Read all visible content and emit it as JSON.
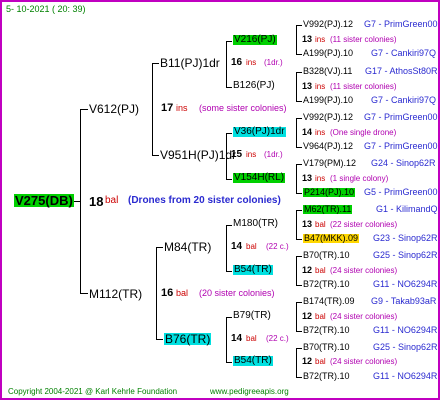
{
  "header": {
    "date": "5- 10-2021 ( 20: 39)"
  },
  "root": {
    "name": "V275(DB)",
    "num": "18",
    "unit": "bal",
    "note": "(Drones from 20 sister colonies)"
  },
  "gen1": [
    {
      "name": "V612(PJ)",
      "num": "17",
      "unit": "ins",
      "note": "(some sister colonies)"
    },
    {
      "name": "M112(TR)",
      "num": "16",
      "unit": "bal",
      "note": "(20 sister colonies)"
    }
  ],
  "gen2": [
    {
      "name": "B11(PJ)1dr",
      "num": "16",
      "unit": "ins",
      "note": "(1dr.)"
    },
    {
      "name": "V951H(PJ)1dr",
      "num": "15",
      "unit": "ins",
      "note": "(1dr.)"
    },
    {
      "name": "M84(TR)",
      "num": "14",
      "unit": "bal",
      "note": "(22 c.)"
    },
    {
      "name": "B76(TR)",
      "num": "14",
      "unit": "bal",
      "note": "(22 c.)"
    }
  ],
  "gen3": [
    {
      "name": "V216(PJ)",
      "num": "13",
      "unit": "ins",
      "note": "(11 sister colonies)"
    },
    {
      "name": "B126(PJ)",
      "num": "13",
      "unit": "ins",
      "note": "(11 sister colonies)"
    },
    {
      "name": "V36(PJ)1dr",
      "num": "14",
      "unit": "ins",
      "note": "(One single drone)"
    },
    {
      "name": "V154H(RL)",
      "num": "13",
      "unit": "ins",
      "note": "(1 single colony)"
    },
    {
      "name": "M180(TR)",
      "num": "13",
      "unit": "bal",
      "note": "(22 sister colonies)"
    },
    {
      "name": "B54(TR)",
      "num": "12",
      "unit": "bal",
      "note": "(24 sister colonies)"
    },
    {
      "name": "B79(TR)",
      "num": "12",
      "unit": "bal",
      "note": "(24 sister colonies)"
    },
    {
      "name": "B54(TR)",
      "num": "12",
      "unit": "bal",
      "note": "(24 sister colonies)"
    }
  ],
  "gen4": [
    {
      "name": "V992(PJ).12",
      "code": "G7 - PrimGreen00"
    },
    {
      "name": "A199(PJ).10",
      "code": "G7 - Cankiri97Q"
    },
    {
      "name": "B328(VJ).11",
      "code": "G17 - AthosSt80R"
    },
    {
      "name": "A199(PJ).10",
      "code": "G7 - Cankiri97Q"
    },
    {
      "name": "V992(PJ).12",
      "code": "G7 - PrimGreen00"
    },
    {
      "name": "V964(PJ).12",
      "code": "G7 - PrimGreen00"
    },
    {
      "name": "V179(PM).12",
      "code": "G24 - Sinop62R"
    },
    {
      "name": "P214(PJ).10",
      "code": "G5 - PrimGreen00"
    },
    {
      "name": "M62(TR).11",
      "code": "G1 - KilimandQ"
    },
    {
      "name": "B47(MKK).09",
      "code": "G23 - Sinop62R"
    },
    {
      "name": "B70(TR).10",
      "code": "G25 - Sinop62R"
    },
    {
      "name": "B72(TR).10",
      "code": "G11 - NO6294R"
    },
    {
      "name": "B174(TR).09",
      "code": "G9 - Takab93aR"
    },
    {
      "name": "B72(TR).10",
      "code": "G11 - NO6294R"
    },
    {
      "name": "B70(TR).10",
      "code": "G25 - Sinop62R"
    },
    {
      "name": "B72(TR).10",
      "code": "G11 - NO6294R"
    }
  ],
  "footer": {
    "copyright": "Copyright 2004-2021 @ Karl Kehrle Foundation",
    "url": "www.pedigreeapis.org"
  }
}
